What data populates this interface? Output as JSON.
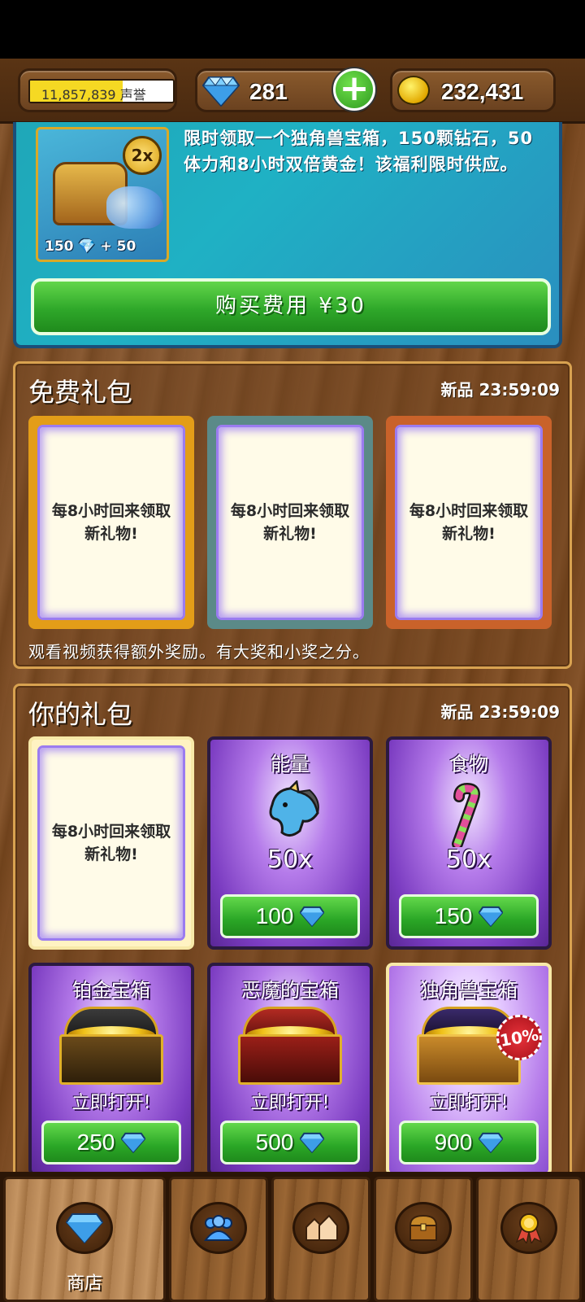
{
  "header": {
    "reputation_text": "11,857,839 声誉",
    "reputation_progress": 0.65,
    "gems": "281",
    "gold": "232,431"
  },
  "promo": {
    "description": "限时领取一个独角兽宝箱，150颗钻石，50体力和8小时双倍黄金！该福利限时供应。",
    "image_badge": "2x",
    "image_caption": "150 💎 + 50",
    "buy_label": "购买费用 ¥30"
  },
  "free_gifts": {
    "title": "免费礼包",
    "timer": "新品 23:59:09",
    "cards": [
      {
        "text": "每8小时回来领取新礼物!",
        "border": "#e39d18"
      },
      {
        "text": "每8小时回来领取新礼物!",
        "border": "#5b8a88"
      },
      {
        "text": "每8小时回来领取新礼物!",
        "border": "#c9622a"
      }
    ],
    "note": "观看视频获得额外奖励。有大奖和小奖之分。"
  },
  "your_gifts": {
    "title": "你的礼包",
    "timer": "新品 23:59:09",
    "gift_card_text": "每8小时回来领取新礼物!",
    "items": [
      {
        "name": "能量",
        "qty": "50x",
        "price": "100",
        "icon": "unicorn-icon"
      },
      {
        "name": "食物",
        "qty": "50x",
        "price": "150",
        "icon": "candy-cane-icon"
      },
      {
        "name": "铂金宝箱",
        "open_label": "立即打开!",
        "price": "250",
        "icon": "platinum-chest-icon"
      },
      {
        "name": "恶魔的宝箱",
        "open_label": "立即打开!",
        "price": "500",
        "icon": "demon-chest-icon"
      },
      {
        "name": "独角兽宝箱",
        "open_label": "立即打开!",
        "price": "900",
        "discount": "10%",
        "icon": "unicorn-chest-icon"
      }
    ]
  },
  "nav": {
    "tabs": [
      {
        "label": "商店",
        "icon": "gems-icon",
        "active": true
      },
      {
        "label": "",
        "icon": "people-icon"
      },
      {
        "label": "",
        "icon": "buildings-icon"
      },
      {
        "label": "",
        "icon": "chest-icon"
      },
      {
        "label": "",
        "icon": "medal-icon"
      }
    ]
  },
  "colors": {
    "green_button": "#2fa82a",
    "purple_card": "#7b3cc1",
    "promo_teal": "#1fa7b8"
  }
}
